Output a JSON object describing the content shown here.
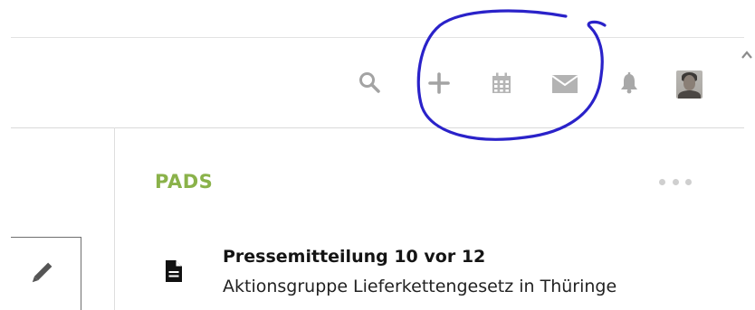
{
  "header": {
    "icons": [
      {
        "name": "search-icon"
      },
      {
        "name": "plus-icon"
      },
      {
        "name": "calendar-icon"
      },
      {
        "name": "mail-icon"
      },
      {
        "name": "bell-icon"
      }
    ],
    "avatar": "user-avatar"
  },
  "pads": {
    "title": "PADS",
    "more_label": "•••",
    "items": [
      {
        "title": "Pressemitteilung 10 vor 12",
        "subtitle": "Aktionsgruppe Lieferkettengesetz in Thüringe",
        "icon": "document-icon"
      }
    ]
  },
  "colors": {
    "accent": "#8ab24a",
    "icon_gray": "#a3a3a3",
    "annotation_blue": "#2a22c9"
  }
}
